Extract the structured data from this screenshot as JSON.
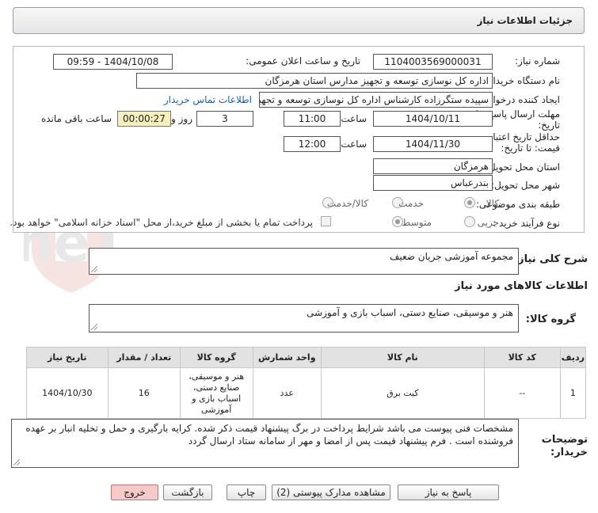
{
  "header": {
    "title": "جزئیات اطلاعات نیاز"
  },
  "form": {
    "need_number": {
      "label": "شماره نیاز:",
      "value": "1104003569000031"
    },
    "announce_datetime": {
      "label": "تاریخ و ساعت اعلان عمومی:",
      "value": "1404/10/08 - 09:59"
    },
    "buyer_org": {
      "label": "نام دستگاه خریدار:",
      "value": "اداره کل نوسازی  توسعه و تجهیز مدارس استان هرمزگان"
    },
    "requester": {
      "label": "ایجاد کننده درخواست:",
      "value": "سپیده ستگرزاده کارشناس اداره کل نوسازی  توسعه و تجهیز مدارس استان هرمزگان",
      "contact_link": "اطلاعات تماس خریدار"
    },
    "reply_deadline": {
      "label_line1": "مهلت ارسال پاسخ: تا",
      "label_line2": "تاریخ:",
      "date": "1404/10/11",
      "time_label": "ساعت",
      "time": "11:00",
      "days": "3",
      "days_label": "روز و",
      "remaining": "00:00:27",
      "remaining_label": "ساعت باقی مانده"
    },
    "price_validity": {
      "label_line1": "حداقل تاریخ اعتبار",
      "label_line2": "قیمت: تا تاریخ:",
      "date": "1404/11/30",
      "time_label": "ساعت",
      "time": "12:00"
    },
    "province": {
      "label": "استان محل تحویل:",
      "value": "هرمزگان"
    },
    "city": {
      "label": "شهر محل تحویل:",
      "value": "بندرعباس"
    },
    "category": {
      "label": "طبقه بندی موضوعی:",
      "options": [
        "کالا",
        "خدمت",
        "کالا/خدمت"
      ],
      "selected": "کالا"
    },
    "purchase_type": {
      "label": "نوع فرآیند خرید :",
      "options": [
        "جزیی",
        "متوسط"
      ],
      "selected": "متوسط",
      "payment_note": "پرداخت تمام یا بخشی از مبلغ خرید،از محل \"اسناد خزانه اسلامی\" خواهد بود."
    }
  },
  "description": {
    "label": "شرح کلی نیاز:",
    "value": "مجموعه آموزشی جریان ضعیف"
  },
  "goods_section": {
    "title": "اطلاعات کالاهای مورد نیاز"
  },
  "goods_group": {
    "label": "گروه کالا:",
    "value": "هنر و موسیقی، صنایع دستی، اسباب بازی و آموزشی"
  },
  "table": {
    "headers": [
      "ردیف",
      "کد کالا",
      "نام کالا",
      "واحد شمارش",
      "گروه کالا",
      "تعداد / مقدار",
      "تاریخ نیاز"
    ],
    "rows": [
      [
        "1",
        "--",
        "کیت برق",
        "عدد",
        "هنر و موسیقی، صنایع دستی، اسباب بازی و آموزشی",
        "16",
        "1404/10/30"
      ]
    ]
  },
  "buyer_notes": {
    "label": "توضیحات خریدار:",
    "value": "مشخصات فنی پیوست می باشد شرایط پرداخت در برگ پیشنهاد قیمت ذکر شده. کرایه بارگیری و حمل و تخلیه انبار بر عهده فروشنده است . فرم پیشنهاد قیمت پس از امضا و مهر از سامانه ستاد ارسال گردد"
  },
  "buttons": {
    "reply": "پاسخ به نیاز",
    "view_docs": "مشاهده مدارک پیوستی (2)",
    "print": "چاپ",
    "back": "بازگشت",
    "exit": "خروج"
  },
  "watermark": "AriaTender.neT",
  "colors": {
    "remaining_bg": "#f4efbd",
    "link": "#1a5fb4",
    "exit_bg": "#f7caca"
  }
}
